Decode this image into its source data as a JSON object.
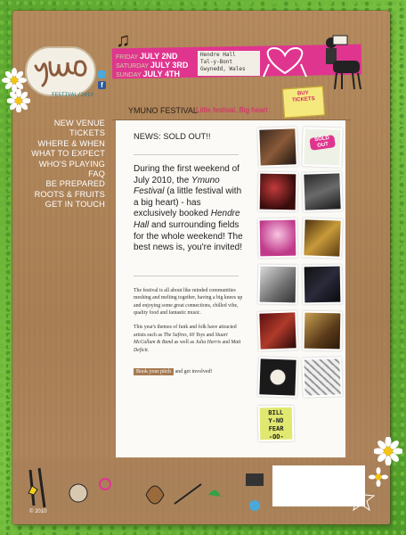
{
  "brand": {
    "festival_label": "FESTIVAL/2010",
    "year_tag": "© 2010"
  },
  "dates": [
    {
      "day": "FRIDAY",
      "date": "July 2nd"
    },
    {
      "day": "SATURDAY",
      "date": "July 3rd"
    },
    {
      "day": "SUNDAY",
      "date": "July 4th"
    }
  ],
  "venue": [
    "Hendre Hall",
    "Tal-y-Bont",
    "Gwynedd, Wales"
  ],
  "ticket": {
    "line1": "BUY",
    "line2": "TICKETS"
  },
  "nav": [
    "NEW VENUE",
    "TICKETS",
    "WHERE & WHEN",
    "WHAT TO EXPECT",
    "WHO'S PLAYING",
    "FAQ",
    "BE PREPARED",
    "ROOTS & FRUITS",
    "GET IN TOUCH"
  ],
  "header": {
    "title": "YMUNO FESTIVAL",
    "tagline": "Little festival, Big heart"
  },
  "content": {
    "news": "NEWS: SOLD OUT!!",
    "intro_a": "During the first weekend of July 2010, the ",
    "intro_em": "Ymuno Festival",
    "intro_b": " (a little festival with a big heart) - has exclusively booked ",
    "intro_em2": "Hendre Hall",
    "intro_c": " and surrounding fields for the whole weekend! The best news is, you're invited!",
    "p1": "The festival is all about like minded communities meshing and melting together, having a big knees up and enjoying some great connections, chilled vibe, quality food and fantastic music.",
    "p2_a": "This year's themes of funk and folk have attracted artists such as ",
    "p2_em1": "The Safires",
    "p2_b": ", ",
    "p2_em2": "60 Toys",
    "p2_c": " and ",
    "p2_em3": "Stuart McCullum & Band",
    "p2_d": " as well as ",
    "p2_em4": "Julia Harris",
    "p2_e": " and ",
    "p2_em5": "Matt Deficit",
    "p2_f": ".",
    "pitch_button": "Book your pitch",
    "pitch_after": " and get involved!"
  },
  "badge": {
    "line1": "SOLD",
    "line2": "OUT"
  },
  "billy": [
    "BILL",
    "Y-NO",
    "FEAR",
    "-OO-"
  ],
  "colors": {
    "accent_pink": "#e0358f",
    "cardboard": "#b08760",
    "grass": "#6fb83a"
  }
}
